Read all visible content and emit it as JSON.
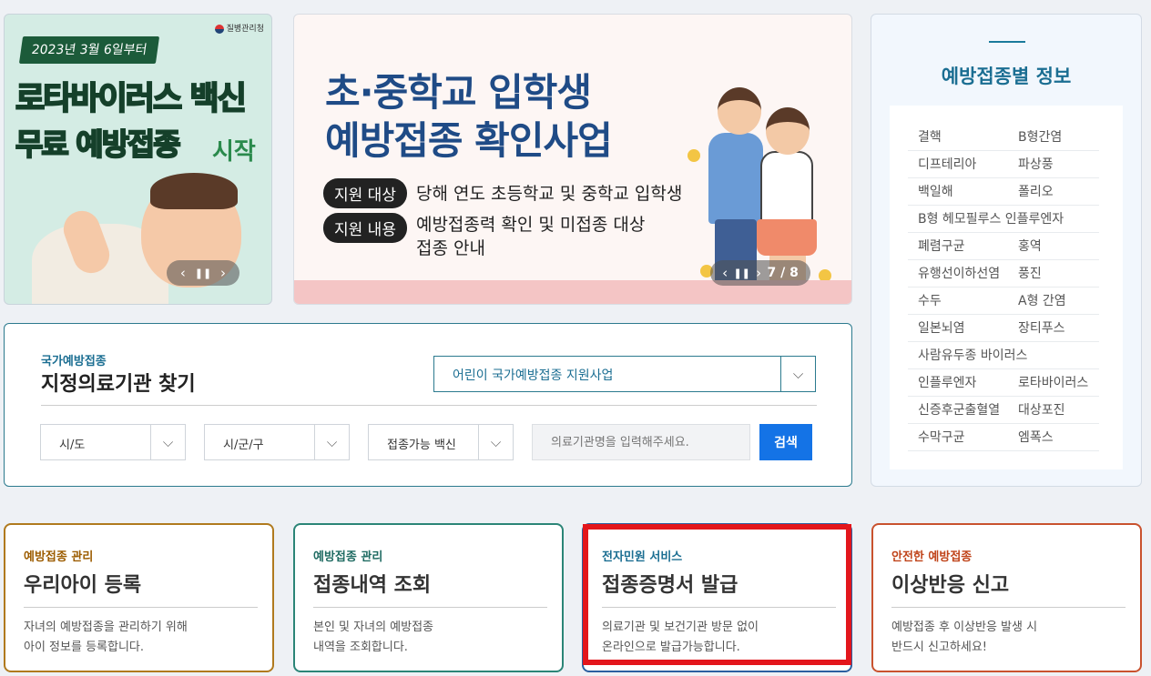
{
  "banner_left": {
    "date": "2023년 3월 6일부터",
    "agency": "질병관리청",
    "title_line1": "로타바이러스 백신",
    "title_line2": "무료 예방접종",
    "title_line3": "시작"
  },
  "banner_mid": {
    "title_line1": "초·중학교 입학생",
    "title_line2": "예방접종 확인사업",
    "row1_badge": "지원 대상",
    "row1_text": "당해 연도 초등학교 및 중학교 입학생",
    "row2_badge": "지원 내용",
    "row2_text_line1": "예방접종력 확인 및 미접종 대상",
    "row2_text_line2": "접종 안내",
    "slide_counter": "7 / 8"
  },
  "info_panel": {
    "title": "예방접종별 정보",
    "items": [
      [
        "결핵",
        "B형간염"
      ],
      [
        "디프테리아",
        "파상풍"
      ],
      [
        "백일해",
        "폴리오"
      ],
      [
        "B형 헤모필루스 인플루엔자"
      ],
      [
        "폐렴구균",
        "홍역"
      ],
      [
        "유행선이하선염",
        "풍진"
      ],
      [
        "수두",
        "A형 간염"
      ],
      [
        "일본뇌염",
        "장티푸스"
      ],
      [
        "사람유두종 바이러스"
      ],
      [
        "인플루엔자",
        "로타바이러스"
      ],
      [
        "신증후군출혈열",
        "대상포진"
      ],
      [
        "수막구균",
        "엠폭스"
      ]
    ]
  },
  "search": {
    "subtitle": "국가예방접종",
    "title": "지정의료기관 찾기",
    "program_value": "어린이 국가예방접종 지원사업",
    "sido_value": "시/도",
    "sigungu_value": "시/군/구",
    "vaccine_value": "접종가능 백신",
    "hospital_placeholder": "의료기관명을 입력해주세요.",
    "search_label": "검색"
  },
  "services": [
    {
      "category": "예방접종 관리",
      "title": "우리아이 등록",
      "desc1": "자녀의 예방접종을 관리하기 위해",
      "desc2": "아이 정보를 등록합니다."
    },
    {
      "category": "예방접종 관리",
      "title": "접종내역 조회",
      "desc1": "본인 및 자녀의 예방접종",
      "desc2": "내역을 조회합니다."
    },
    {
      "category": "전자민원 서비스",
      "title": "접종증명서 발급",
      "desc1": "의료기관 및 보건기관 방문 없이",
      "desc2": "온라인으로 발급가능합니다."
    },
    {
      "category": "안전한 예방접종",
      "title": "이상반응 신고",
      "desc1": "예방접종 후 이상반응 발생 시",
      "desc2": "반드시 신고하세요!"
    }
  ],
  "icons": {
    "prev": "chevron-left-icon",
    "pause": "pause-icon",
    "next": "chevron-right-icon",
    "dropdown": "chevron-down-icon"
  },
  "colors": {
    "accent": "#1b6e92",
    "search_button": "#1473e6",
    "highlight": "#e3161c"
  }
}
